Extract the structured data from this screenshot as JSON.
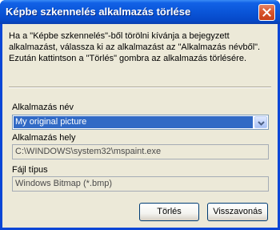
{
  "window": {
    "title": "Képbe szkennelés alkalmazás törlése",
    "close_icon": "close-icon"
  },
  "message": "Ha a \"Képbe szkennelés\"-ből törölni kívánja a bejegyzett alkalmazást, válassza ki az alkalmazást az \"Alkalmazás névből\". Ezután kattintson a \"Törlés\" gombra az alkalmazás törlésére.",
  "app_name": {
    "label": "Alkalmazás név",
    "selected": "My original picture"
  },
  "app_location": {
    "label": "Alkalmazás hely",
    "value": "C:\\WINDOWS\\system32\\mspaint.exe"
  },
  "file_type": {
    "label": "Fájl típus",
    "value": "Windows Bitmap (*.bmp)"
  },
  "buttons": {
    "delete": "Törlés",
    "cancel": "Visszavonás"
  },
  "colors": {
    "titlebar": "#0a55d8",
    "selection": "#316ac5",
    "dialog_bg": "#ece9d8"
  }
}
